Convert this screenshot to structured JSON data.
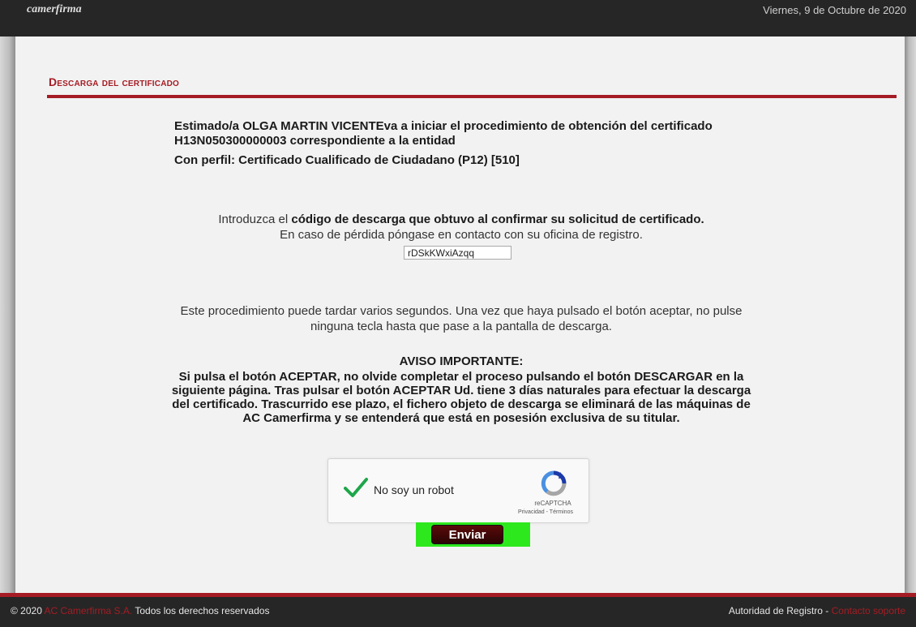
{
  "header": {
    "logo_text": "camerfirma",
    "date": "Viernes, 9 de Octubre de 2020"
  },
  "section": {
    "title": "Descarga del certificado"
  },
  "intro": {
    "line1": "Estimado/a OLGA MARTIN VICENTEva a iniciar el procedimiento de obtención del certificado H13N050300000003 correspondiente a la entidad",
    "profile": "Con perfil: Certificado Cualificado de Ciudadano (P12) [510]"
  },
  "instructions": {
    "prefix": "Introduzca el ",
    "bold": "código de descarga que obtuvo al confirmar su solicitud de certificado.",
    "line2": "En caso de pérdida póngase en contacto con su oficina de registro."
  },
  "code_input": {
    "value": "rDSkKWxiAzqq"
  },
  "wait_text": "Este procedimiento puede tardar varios segundos. Una vez que haya pulsado el botón aceptar, no pulse ninguna tecla hasta que pase a la pantalla de descarga.",
  "notice": {
    "title": "AVISO IMPORTANTE:",
    "body": "Si pulsa el botón ACEPTAR, no olvide completar el proceso pulsando el botón DESCARGAR en la siguiente página. Tras pulsar el botón ACEPTAR Ud. tiene 3 días naturales para efectuar la descarga del certificado. Trascurrido ese plazo, el fichero objeto de descarga se eliminará de las máquinas de AC Camerfirma y se entenderá que está en posesión exclusiva de su titular."
  },
  "captcha": {
    "label": "No soy un robot",
    "brand": "reCAPTCHA",
    "privacy": "Privacidad",
    "separator": " - ",
    "terms": "Términos",
    "checked": true
  },
  "submit": {
    "label": "Enviar"
  },
  "footer": {
    "copyright": "© 2020 ",
    "company": "AC Camerfirma S.A.",
    "rights": " Todos los derechos reservados",
    "authority": "Autoridad de Registro - ",
    "support": "Contacto soporte"
  },
  "colors": {
    "accent": "#a51c24",
    "topbar": "#262626",
    "submit_highlight": "#2ee81e"
  }
}
